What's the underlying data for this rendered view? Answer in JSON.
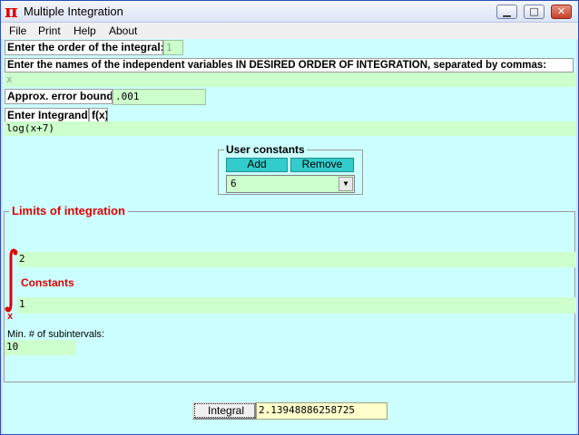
{
  "window": {
    "title": "Multiple Integration",
    "icon_glyph": "π",
    "controls": {
      "minimize": "▁",
      "maximize": "□",
      "close": "✕"
    }
  },
  "menu": [
    "File",
    "Print",
    "Help",
    "About"
  ],
  "order": {
    "label": "Enter the order of the integral:",
    "value": "1"
  },
  "variables": {
    "label": "Enter the names of the independent variables IN DESIRED ORDER OF INTEGRATION, separated by commas:",
    "value": "x"
  },
  "error_bound": {
    "label": "Approx. error bound:",
    "value": ".001"
  },
  "integrand": {
    "label": "Enter Integrand:",
    "fx_label": "f(x)",
    "value": "log(x+7)"
  },
  "user_constants": {
    "title": "User constants",
    "add_label": "Add",
    "remove_label": "Remove",
    "selected": "6"
  },
  "limits": {
    "title": "Limits of integration",
    "upper": "2",
    "lower": "1",
    "constants_label": "Constants",
    "variable": "x",
    "subintervals_label": "Min. # of subintervals:",
    "subintervals_value": "10"
  },
  "integral": {
    "button_label": "Integral",
    "result": "2.13948886258725"
  },
  "colors": {
    "background": "#ccffff",
    "field": "#ccffcc",
    "accent_red": "#e00000",
    "button_cyan": "#33cccc",
    "result": "#ffffcc"
  }
}
